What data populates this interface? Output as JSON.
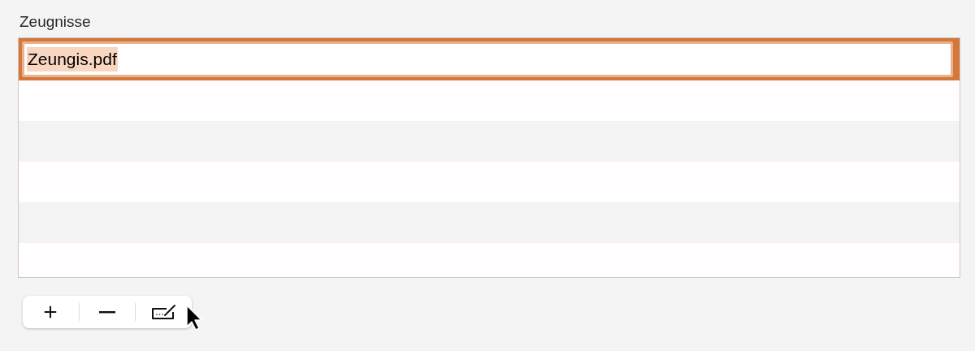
{
  "label": "Zeugnisse",
  "files": [
    {
      "name": "Zeungis.pdf",
      "selected": true,
      "editing": true
    }
  ],
  "toolbar": [
    {
      "kind": "add"
    },
    {
      "kind": "remove"
    },
    {
      "kind": "edit"
    }
  ]
}
